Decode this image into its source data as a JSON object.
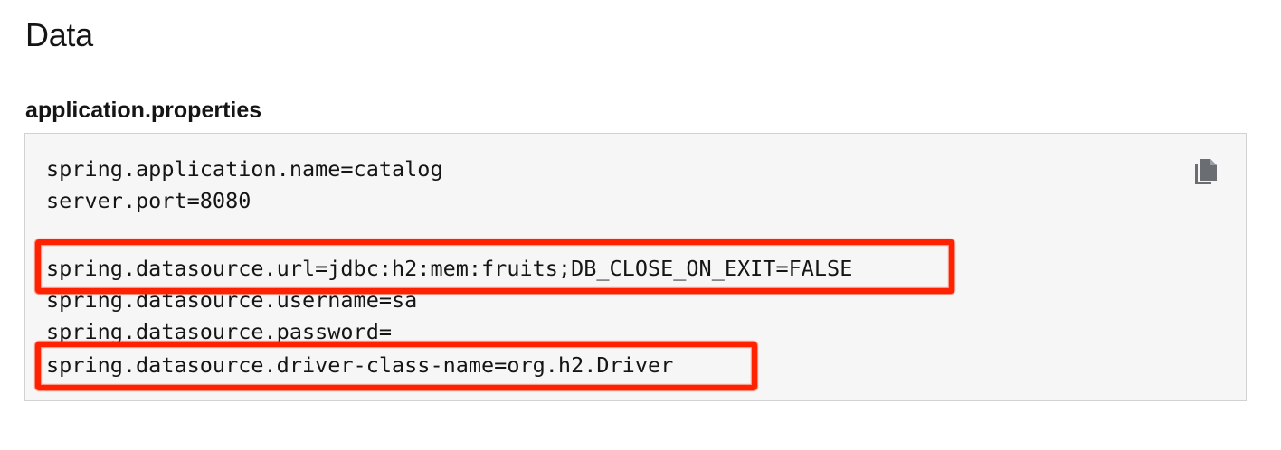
{
  "section": {
    "title": "Data"
  },
  "code_block": {
    "filename": "application.properties",
    "lines": [
      "spring.application.name=catalog",
      "server.port=8080",
      "spring.datasource.url=jdbc:h2:mem:fruits;DB_CLOSE_ON_EXIT=FALSE",
      "spring.datasource.username=sa",
      "spring.datasource.password=",
      "spring.datasource.driver-class-name=org.h2.Driver"
    ],
    "copy_icon": "copy-icon"
  },
  "annotations": {
    "highlight_color": "#ff2200",
    "highlighted_lines": [
      2,
      5
    ]
  }
}
